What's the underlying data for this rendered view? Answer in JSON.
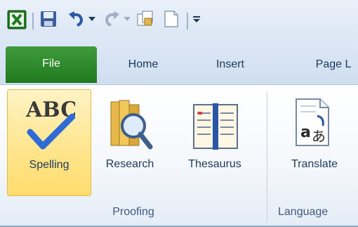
{
  "quick_access": {
    "icons": [
      "excel-app-icon",
      "save-icon",
      "undo-icon",
      "undo-dropdown-icon",
      "redo-icon",
      "redo-dropdown-icon",
      "copy-icon",
      "new-document-icon",
      "customize-toolbar-icon"
    ]
  },
  "tabs": [
    {
      "label": "File"
    },
    {
      "label": "Home"
    },
    {
      "label": "Insert"
    },
    {
      "label": "Page L"
    }
  ],
  "ribbon": {
    "groups": [
      {
        "label": "Proofing",
        "buttons": [
          {
            "label": "Spelling",
            "icon": "spelling-abc-check-icon",
            "selected": true
          },
          {
            "label": "Research",
            "icon": "research-books-magnifier-icon"
          },
          {
            "label": "Thesaurus",
            "icon": "thesaurus-book-icon"
          }
        ]
      },
      {
        "label": "Language",
        "buttons": [
          {
            "label": "Translate",
            "icon": "translate-icon"
          }
        ]
      }
    ]
  },
  "colors": {
    "file_tab": "#2e8b2e",
    "selected_bg": "#ffe48a",
    "text": "#1e395b"
  }
}
